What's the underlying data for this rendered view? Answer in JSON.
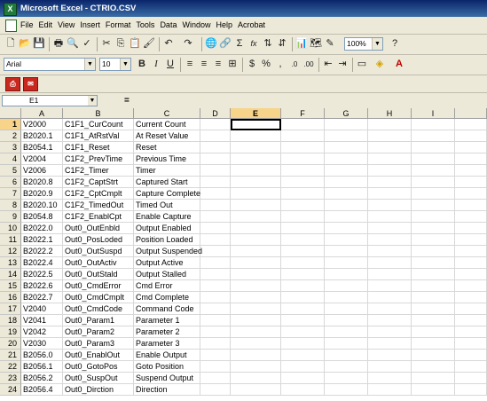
{
  "window": {
    "title": "Microsoft Excel - CTRIO.CSV",
    "app_icon": "X"
  },
  "menu": [
    "File",
    "Edit",
    "View",
    "Insert",
    "Format",
    "Tools",
    "Data",
    "Window",
    "Help",
    "Acrobat"
  ],
  "toolbar": {
    "zoom": "100%",
    "font_name": "Arial",
    "font_size": "10",
    "bold": "B",
    "italic": "I",
    "underline": "U",
    "currency": "$",
    "percent": "%",
    "comma": ",",
    "autosum": "Σ",
    "fx": "fx"
  },
  "pdf_buttons": [
    "pdf-icon",
    "pdf-email-icon"
  ],
  "formula_bar": {
    "cell_ref": "E1",
    "equals": "=",
    "content": ""
  },
  "columns": [
    "A",
    "B",
    "C",
    "D",
    "E",
    "F",
    "G",
    "H",
    "I"
  ],
  "selected_column": "E",
  "selected_row": "1",
  "rows": [
    {
      "n": "1",
      "a": "V2000",
      "b": "C1F1_CurCount",
      "c": "Current Count"
    },
    {
      "n": "2",
      "a": "B2020.1",
      "b": "C1F1_AtRstVal",
      "c": "At Reset Value"
    },
    {
      "n": "3",
      "a": "B2054.1",
      "b": "C1F1_Reset",
      "c": "Reset"
    },
    {
      "n": "4",
      "a": "V2004",
      "b": "C1F2_PrevTime",
      "c": "Previous Time"
    },
    {
      "n": "5",
      "a": "V2006",
      "b": "C1F2_Timer",
      "c": "Timer"
    },
    {
      "n": "6",
      "a": "B2020.8",
      "b": "C1F2_CaptStrt",
      "c": "Captured Start"
    },
    {
      "n": "7",
      "a": "B2020.9",
      "b": "C1F2_CptCmplt",
      "c": "Capture Complete"
    },
    {
      "n": "8",
      "a": "B2020.10",
      "b": "C1F2_TimedOut",
      "c": "Timed Out"
    },
    {
      "n": "9",
      "a": "B2054.8",
      "b": "C1F2_EnablCpt",
      "c": "Enable Capture"
    },
    {
      "n": "10",
      "a": "B2022.0",
      "b": "Out0_OutEnbld",
      "c": "Output Enabled"
    },
    {
      "n": "11",
      "a": "B2022.1",
      "b": "Out0_PosLoded",
      "c": "Position Loaded"
    },
    {
      "n": "12",
      "a": "B2022.2",
      "b": "Out0_OutSuspd",
      "c": "Output Suspended"
    },
    {
      "n": "13",
      "a": "B2022.4",
      "b": "Out0_OutActiv",
      "c": "Output Active"
    },
    {
      "n": "14",
      "a": "B2022.5",
      "b": "Out0_OutStald",
      "c": "Output Stalled"
    },
    {
      "n": "15",
      "a": "B2022.6",
      "b": "Out0_CmdError",
      "c": "Cmd Error"
    },
    {
      "n": "16",
      "a": "B2022.7",
      "b": "Out0_CmdCmplt",
      "c": "Cmd Complete"
    },
    {
      "n": "17",
      "a": "V2040",
      "b": "Out0_CmdCode",
      "c": "Command Code"
    },
    {
      "n": "18",
      "a": "V2041",
      "b": "Out0_Param1",
      "c": "Parameter 1"
    },
    {
      "n": "19",
      "a": "V2042",
      "b": "Out0_Param2",
      "c": "Parameter 2"
    },
    {
      "n": "20",
      "a": "V2030",
      "b": "Out0_Param3",
      "c": "Parameter 3"
    },
    {
      "n": "21",
      "a": "B2056.0",
      "b": "Out0_EnablOut",
      "c": "Enable Output"
    },
    {
      "n": "22",
      "a": "B2056.1",
      "b": "Out0_GotoPos",
      "c": "Goto Position"
    },
    {
      "n": "23",
      "a": "B2056.2",
      "b": "Out0_SuspOut",
      "c": "Suspend Output"
    },
    {
      "n": "24",
      "a": "B2056.4",
      "b": "Out0_Dirction",
      "c": "Direction"
    }
  ]
}
